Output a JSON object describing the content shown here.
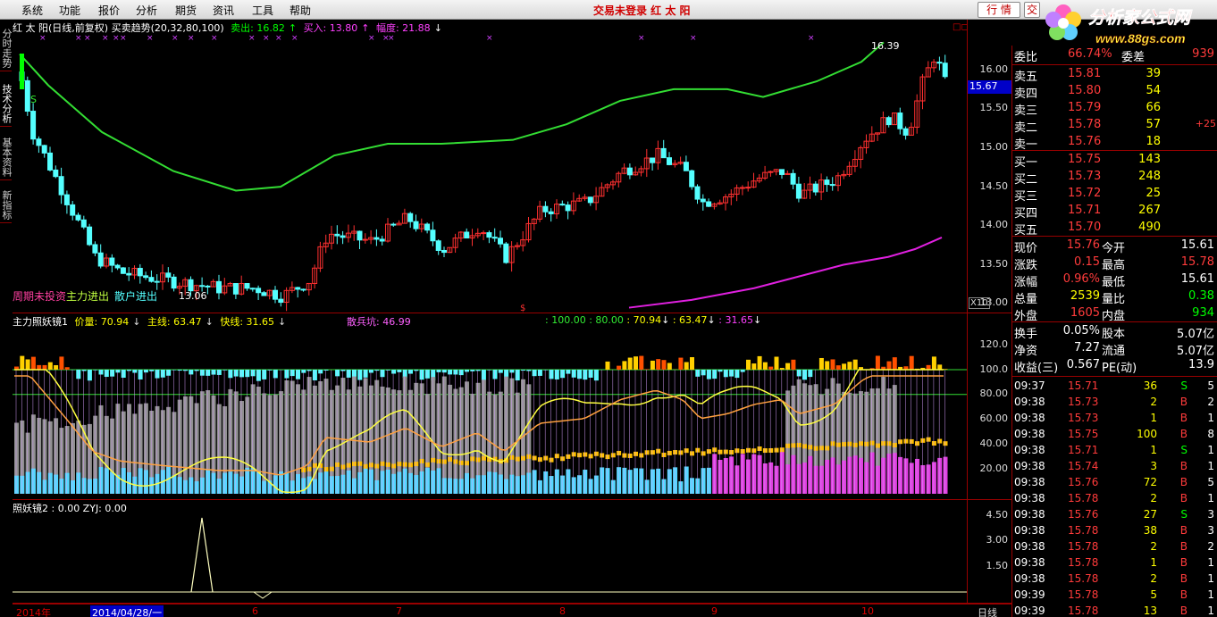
{
  "menu": {
    "items": [
      "系统",
      "功能",
      "报价",
      "分析",
      "期货",
      "资讯",
      "工具",
      "帮助"
    ],
    "status": "交易未登录   红 太 阳",
    "quote_button": "行 情",
    "trade_button": "交",
    "logo_text": "分析家公式网",
    "logo_url": "www.88gs.com"
  },
  "left_tabs": [
    "分时走势",
    "技术分析",
    "基本资料",
    "新指标"
  ],
  "main_chart": {
    "title": "红 太 阳(日线,前复权) 买卖趋势(20,32,80,100)",
    "sell_label": "卖出: 16.82",
    "buy_label": "买入: 13.80",
    "range_label": "幅度: 21.88",
    "high_marker": "16.39",
    "low_marker": "13.06",
    "s_marker": "S",
    "bottom_labels": [
      "周期未投资",
      "主力进出",
      "散户进出"
    ],
    "current_price_box": "15.67",
    "y_ticks": [
      "16.00",
      "15.50",
      "15.00",
      "14.50",
      "14.00",
      "13.50",
      "13.00"
    ],
    "zoom_label": "X10",
    "colors": {
      "up": "#ff3030",
      "down": "#54ffff",
      "ma_green": "#33dd33",
      "ma_magenta": "#e020e0"
    }
  },
  "indicator1": {
    "title": "主力照妖镜1",
    "values": [
      "价量: 70.94",
      "主线: 63.47",
      "快线: 31.65"
    ],
    "extra": "散兵坑: 46.99",
    "refs": [
      ": 100.00",
      ": 80.00",
      ": 70.94",
      ": 63.47",
      ": 31.65"
    ],
    "y_ticks": [
      "120.0",
      "100.0",
      "80.00",
      "60.00",
      "40.00",
      "20.00"
    ]
  },
  "indicator2": {
    "title": "照妖镜2 : 0.00  ZYJ: 0.00",
    "y_ticks": [
      "4.50",
      "3.00",
      "1.50"
    ]
  },
  "date_axis": {
    "labels": [
      "2014年",
      "2014/04/28/一",
      "6",
      "7",
      "8",
      "9",
      "10"
    ],
    "period": "日线"
  },
  "quote": {
    "title": "委比",
    "weibi": "66.74%",
    "weicha_label": "委差",
    "weicha": "939",
    "asks": [
      {
        "label": "卖五",
        "price": "15.81",
        "vol": "39",
        "chg": ""
      },
      {
        "label": "卖四",
        "price": "15.80",
        "vol": "54",
        "chg": ""
      },
      {
        "label": "卖三",
        "price": "15.79",
        "vol": "66",
        "chg": ""
      },
      {
        "label": "卖二",
        "price": "15.78",
        "vol": "57",
        "chg": "+25"
      },
      {
        "label": "卖一",
        "price": "15.76",
        "vol": "18",
        "chg": ""
      }
    ],
    "bids": [
      {
        "label": "买一",
        "price": "15.75",
        "vol": "143"
      },
      {
        "label": "买二",
        "price": "15.73",
        "vol": "248"
      },
      {
        "label": "买三",
        "price": "15.72",
        "vol": "25"
      },
      {
        "label": "买四",
        "price": "15.71",
        "vol": "267"
      },
      {
        "label": "买五",
        "price": "15.70",
        "vol": "490"
      }
    ],
    "stats": [
      {
        "l1": "现价",
        "v1": "15.76",
        "c1": "red",
        "l2": "今开",
        "v2": "15.61",
        "c2": "white"
      },
      {
        "l1": "涨跌",
        "v1": "0.15",
        "c1": "red",
        "l2": "最高",
        "v2": "15.78",
        "c2": "red"
      },
      {
        "l1": "涨幅",
        "v1": "0.96%",
        "c1": "red",
        "l2": "最低",
        "v2": "15.61",
        "c2": "white"
      },
      {
        "l1": "总量",
        "v1": "2539",
        "c1": "yellow",
        "l2": "量比",
        "v2": "0.38",
        "c2": "green"
      },
      {
        "l1": "外盘",
        "v1": "1605",
        "c1": "red",
        "l2": "内盘",
        "v2": "934",
        "c2": "green"
      }
    ],
    "stats2": [
      {
        "l1": "换手",
        "v1": "0.05%",
        "l2": "股本",
        "v2": "5.07亿"
      },
      {
        "l1": "净资",
        "v1": "7.27",
        "l2": "流通",
        "v2": "5.07亿"
      },
      {
        "l1": "收益(三)",
        "v1": "0.567",
        "l2": "PE(动)",
        "v2": "13.9"
      }
    ],
    "ticks": [
      {
        "t": "09:37",
        "p": "15.71",
        "v": "36",
        "s": "S",
        "n": "5"
      },
      {
        "t": "09:38",
        "p": "15.73",
        "v": "2",
        "s": "B",
        "n": "2"
      },
      {
        "t": "09:38",
        "p": "15.73",
        "v": "1",
        "s": "B",
        "n": "1"
      },
      {
        "t": "09:38",
        "p": "15.75",
        "v": "100",
        "s": "B",
        "n": "8"
      },
      {
        "t": "09:38",
        "p": "15.71",
        "v": "1",
        "s": "S",
        "n": "1"
      },
      {
        "t": "09:38",
        "p": "15.74",
        "v": "3",
        "s": "B",
        "n": "1"
      },
      {
        "t": "09:38",
        "p": "15.76",
        "v": "72",
        "s": "B",
        "n": "5"
      },
      {
        "t": "09:38",
        "p": "15.78",
        "v": "2",
        "s": "B",
        "n": "1"
      },
      {
        "t": "09:38",
        "p": "15.76",
        "v": "27",
        "s": "S",
        "n": "3"
      },
      {
        "t": "09:38",
        "p": "15.78",
        "v": "38",
        "s": "B",
        "n": "3"
      },
      {
        "t": "09:38",
        "p": "15.78",
        "v": "2",
        "s": "B",
        "n": "2"
      },
      {
        "t": "09:38",
        "p": "15.78",
        "v": "1",
        "s": "B",
        "n": "1"
      },
      {
        "t": "09:38",
        "p": "15.78",
        "v": "2",
        "s": "B",
        "n": "1"
      },
      {
        "t": "09:39",
        "p": "15.78",
        "v": "5",
        "s": "B",
        "n": "1"
      },
      {
        "t": "09:39",
        "p": "15.78",
        "v": "13",
        "s": "B",
        "n": "1"
      }
    ]
  }
}
